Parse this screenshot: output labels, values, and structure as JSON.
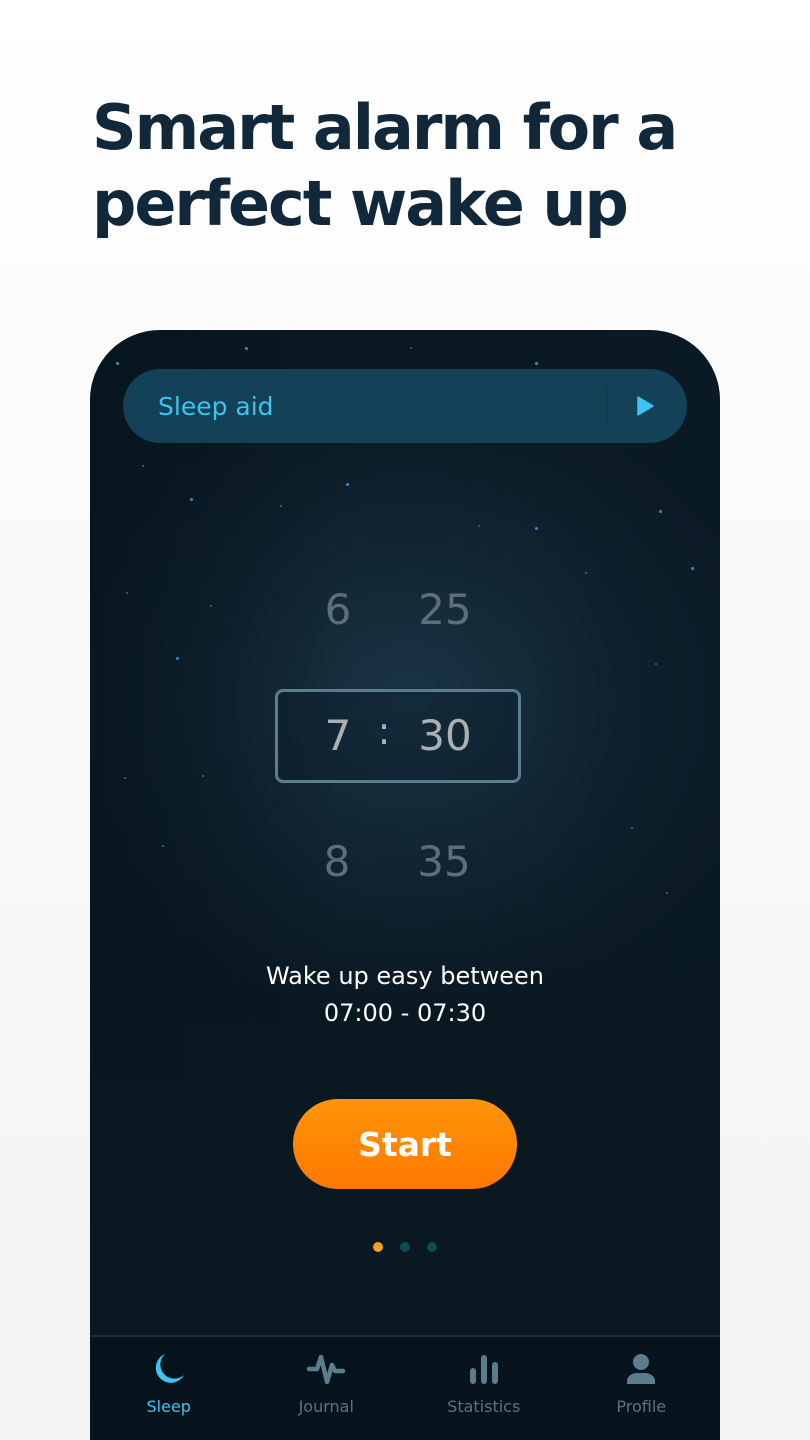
{
  "headline": {
    "line1": "Smart alarm for a",
    "line2": "perfect wake up"
  },
  "sleep_aid": {
    "label": "Sleep aid",
    "play_icon": "play-icon"
  },
  "time_picker": {
    "hours": {
      "previous": "6",
      "selected": "7",
      "next": "8"
    },
    "minutes": {
      "previous": "25",
      "selected": "30",
      "next": "35"
    },
    "separator": ":"
  },
  "wake_window": {
    "line1": "Wake up easy between",
    "line2": "07:00 - 07:30"
  },
  "start_button": {
    "label": "Start"
  },
  "pagination": {
    "total": 3,
    "active_index": 0
  },
  "tabs": [
    {
      "label": "Sleep",
      "icon": "moon-icon",
      "active": true
    },
    {
      "label": "Journal",
      "icon": "pulse-icon",
      "active": false
    },
    {
      "label": "Statistics",
      "icon": "bar-chart-icon",
      "active": false
    },
    {
      "label": "Profile",
      "icon": "person-icon",
      "active": false
    }
  ],
  "colors": {
    "accent_blue": "#3ec3f3",
    "accent_orange": "#ff8a00",
    "background_dark": "#0a1822",
    "headline": "#11283a",
    "inactive": "#5b7382"
  }
}
